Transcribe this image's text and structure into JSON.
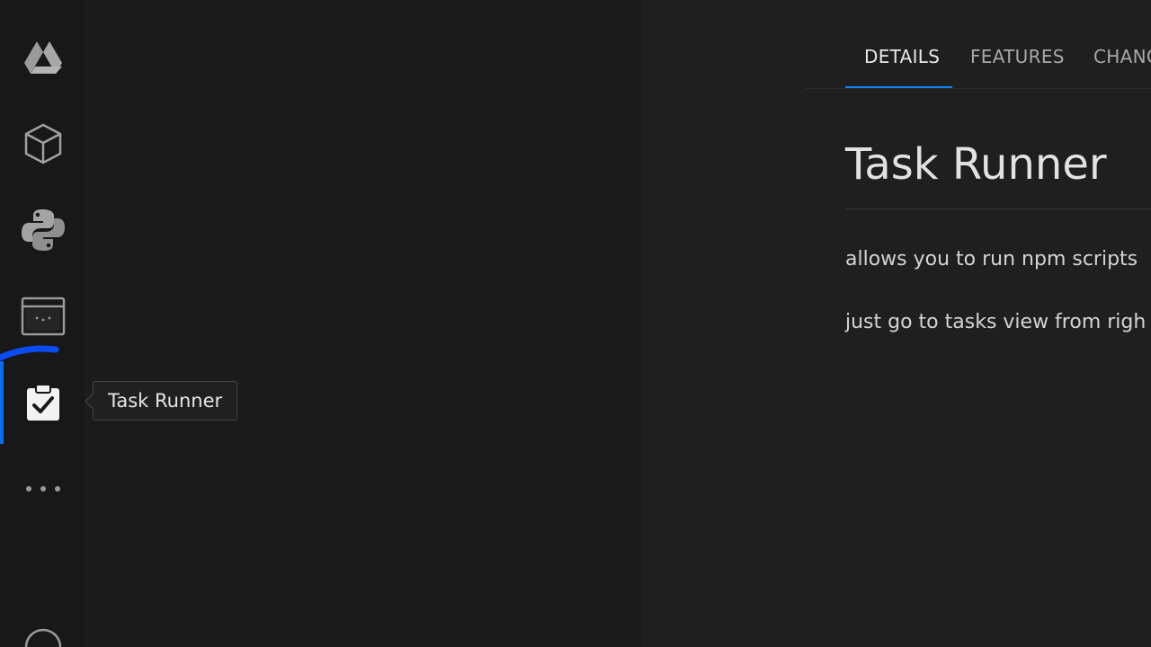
{
  "activity_bar": {
    "items": [
      {
        "icon": "google-drive-icon"
      },
      {
        "icon": "cube-icon"
      },
      {
        "icon": "python-icon"
      },
      {
        "icon": "remote-window-icon"
      },
      {
        "icon": "clipboard-check-icon",
        "active": true
      },
      {
        "icon": "more-icon"
      },
      {
        "icon": "account-icon"
      }
    ]
  },
  "tooltip": {
    "text": "Task Runner"
  },
  "editor": {
    "tabs": [
      {
        "label": "DETAILS",
        "active": true
      },
      {
        "label": "FEATURES"
      },
      {
        "label": "CHANG"
      }
    ],
    "title": "Task Runner",
    "paragraphs": [
      "allows you to run npm scripts",
      "just go to tasks view from righ"
    ]
  },
  "colors": {
    "accent": "#0a84ff",
    "annotation": "#0a4cf0",
    "background": "#1f1f1f"
  }
}
